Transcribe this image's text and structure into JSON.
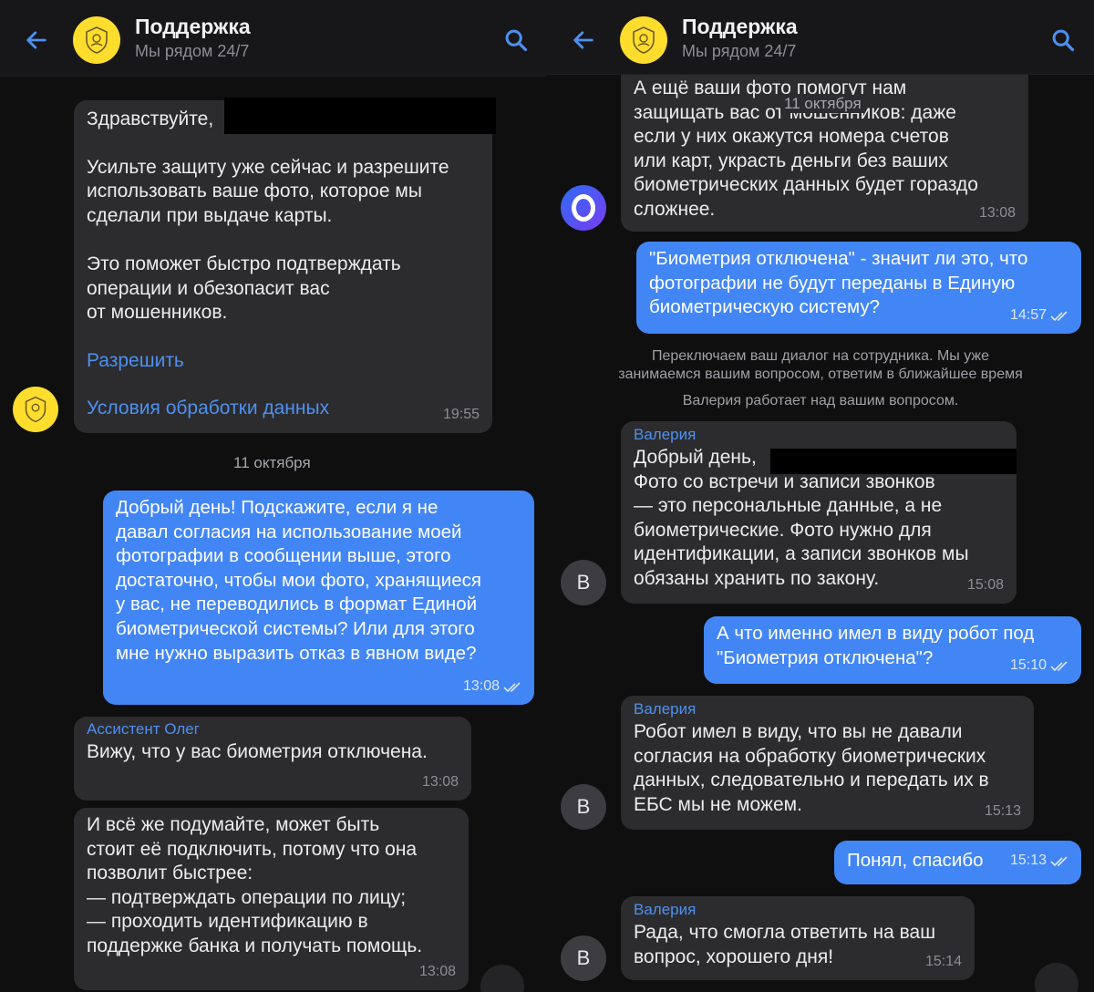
{
  "left": {
    "header": {
      "title": "Поддержка",
      "subtitle": "Мы рядом 24/7"
    },
    "m1": {
      "greeting": "Здравствуйте,",
      "body": "Усильте защиту уже сейчас и разрешите\nиспользовать ваше фото, которое мы\nсделали при выдаче карты.\n\nЭто поможет быстро подтверждать\nоперации и обезопасит вас\nот мошенников.",
      "allow": "Разрешить",
      "terms": "Условия обработки данных",
      "time": "19:55"
    },
    "date": "11 октября",
    "m2": {
      "text": "Добрый день! Подскажите, если я не\nдавал согласия на использование моей\nфотографии в сообщении выше, этого\nдостаточно, чтобы мои фото, хранящиеся\nу вас, не переводились в формат Единой\nбиометрической системы? Или для этого\nмне нужно выразить отказ в явном виде?",
      "time": "13:08"
    },
    "m3": {
      "sender": "Ассистент Олег",
      "text": "Вижу, что у вас биометрия отключена.",
      "time": "13:08"
    },
    "m4": {
      "text": "И всё же подумайте, может быть\nстоит её подключить, потому что она\nпозволит быстрее:\n— подтверждать операции по лицу;\n— проходить идентификацию в\nподдержке банка и получать помощь.",
      "time": "13:08"
    }
  },
  "right": {
    "header": {
      "title": "Поддержка",
      "subtitle": "Мы рядом 24/7"
    },
    "date": "11 октября",
    "m1": {
      "text": "А ещё ваши фото помогут нам\nзащищать вас от мошенников: даже\nесли у них окажутся номера счетов\nили карт, украсть деньги без ваших\nбиометрических данных будет гораздо\nсложнее.",
      "time": "13:08"
    },
    "m2": {
      "text": "\"Биометрия отключена\" - значит ли это, что\nфотографии не будут переданы в Единую\nбиометрическую систему?",
      "time": "14:57"
    },
    "sys1": "Переключаем ваш диалог на сотрудника. Мы уже\nзанимаемся вашим вопросом, ответим в ближайшее время",
    "sys2": "Валерия работает над вашим вопросом.",
    "m3": {
      "sender": "Валерия",
      "greeting": "Добрый день,",
      "text": "Фото со встречи и записи звонков\n— это персональные данные, а не\nбиометрические. Фото нужно для\nидентификации, а записи звонков мы\nобязаны хранить по закону.",
      "time": "15:08",
      "avatar": "В"
    },
    "m4": {
      "text": "А что именно имел в виду робот под\n\"Биометрия отключена\"?",
      "time": "15:10"
    },
    "m5": {
      "sender": "Валерия",
      "text": "Робот имел в виду, что вы не давали\nсогласия на обработку биометрических\nданных, следовательно и передать их в\nЕБС мы не можем.",
      "time": "15:13",
      "avatar": "В"
    },
    "m6": {
      "text": "Понял, спасибо",
      "time": "15:13"
    },
    "m7": {
      "sender": "Валерия",
      "text": "Рада, что смогла ответить на ваш\nвопрос, хорошего дня!",
      "time": "15:14",
      "avatar": "В"
    }
  },
  "colors": {
    "accent": "#4286f5",
    "bubble_in": "#2c2c2e",
    "brand_yellow": "#ffdd2d"
  }
}
